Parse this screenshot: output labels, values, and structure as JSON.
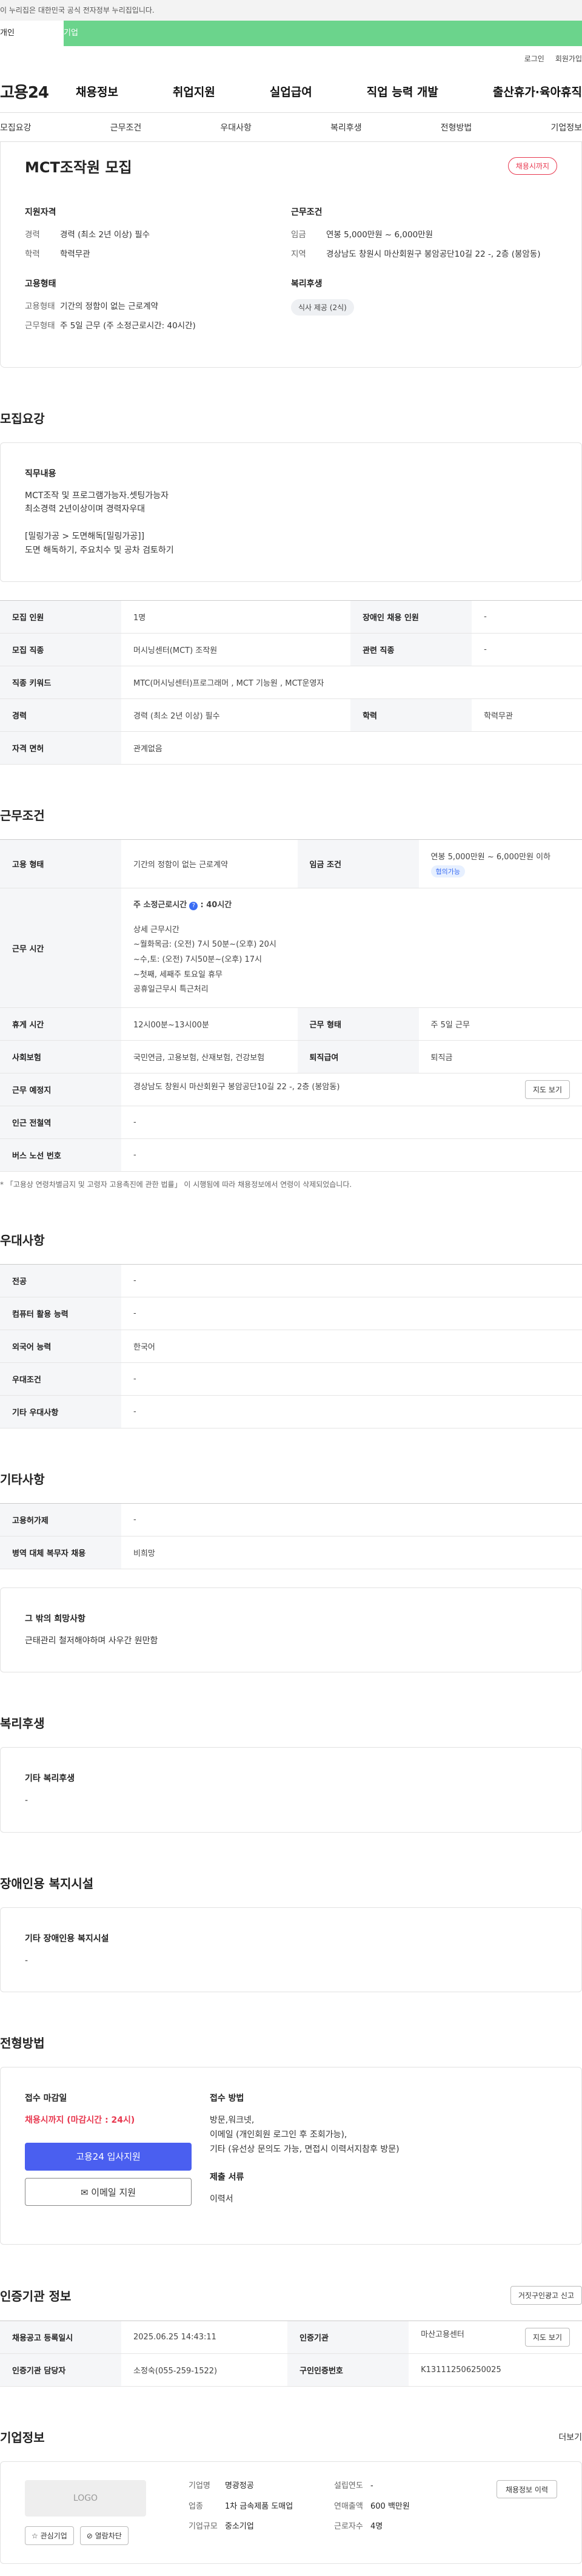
{
  "banner": "이 누리집은 대한민국 공식 전자정부 누리집입니다.",
  "tabs": {
    "person": "개인",
    "company": "기업"
  },
  "util": {
    "login": "로그인",
    "join": "회원가입"
  },
  "logo": "고용24",
  "gnb": [
    "채용정보",
    "취업지원",
    "실업급여",
    "직업 능력 개발",
    "출산휴가·육아휴직"
  ],
  "snb": [
    "모집요강",
    "근무조건",
    "우대사항",
    "복리후생",
    "전형방법",
    "기업정보"
  ],
  "summary": {
    "title": "MCT조작원 모집",
    "badge": "채용시까지",
    "qual_title": "지원자격",
    "career_k": "경력",
    "career_v": "경력 (최소 2년 이상) 필수",
    "edu_k": "학력",
    "edu_v": "학력무관",
    "emp_title": "고용형태",
    "emptype_k": "고용형태",
    "emptype_v": "기간의 정함이 없는 근로계약",
    "worktype_k": "근무형태",
    "worktype_v": "주 5일 근무 (주 소정근로시간: 40시간)",
    "cond_title": "근무조건",
    "wage_k": "임금",
    "wage_v": "연봉 5,000만원 ~ 6,000만원",
    "area_k": "지역",
    "area_v": "경상남도 창원시 마산회원구 봉암공단10길 22 -, 2층 (봉암동)",
    "welfare_title": "복리후생",
    "welfare_chip": "식사 제공 (2식)"
  },
  "recruit": {
    "section": "모집요강",
    "duty_title": "직무내용",
    "duty_lines": [
      "MCT조작 및 프로그램가능자.셋팅가능자",
      "최소경력 2년이상이며 경력자우대",
      "",
      "[밀링가공 > 도면해독[밀링가공]]",
      "도면 해독하기, 주요치수 및 공차 검토하기"
    ],
    "rows": {
      "count_k": "모집 인원",
      "count_v": "1명",
      "disabled_k": "장애인 채용 인원",
      "disabled_v": "-",
      "job_k": "모집 직종",
      "job_v": "머시닝센터(MCT) 조작원",
      "related_k": "관련 직종",
      "related_v": "-",
      "keyword_k": "직종 키워드",
      "keyword_v": "MTC(머시닝센터)프로그래머 , MCT 기능원 , MCT운영자",
      "career_k": "경력",
      "career_v": "경력 (최소 2년 이상) 필수",
      "edu_k": "학력",
      "edu_v": "학력무관",
      "license_k": "자격 면허",
      "license_v": "관계없음"
    }
  },
  "conditions": {
    "section": "근무조건",
    "emp_k": "고용 형태",
    "emp_v": "기간의 정함이 없는 근로계약",
    "wage_k": "임금 조건",
    "wage_v": "연봉 5,000만원 ~ 6,000만원 이하",
    "wage_chip": "협의가능",
    "time_k": "근무 시간",
    "time_head": "주 소정근로시간",
    "time_icon": "?",
    "time_hours": ": 40시간",
    "time_detail_title": "상세 근무시간",
    "time_lines": [
      "~월화목금: (오전) 7시 50분~(오후) 20시",
      "~수,토: (오전) 7시50분~(오후) 17시",
      "~첫째, 세째주 토요일 휴무",
      "공휴일근무시 특근처리"
    ],
    "break_k": "휴게 시간",
    "break_v": "12시00분~13시00분",
    "form_k": "근무 형태",
    "form_v": "주 5일 근무",
    "insure_k": "사회보험",
    "insure_v": "국민연금, 고용보험, 산재보험, 건강보험",
    "retire_k": "퇴직급여",
    "retire_v": "퇴직금",
    "place_k": "근무 예정지",
    "place_v": "경상남도 창원시 마산회원구 봉암공단10길 22 -, 2층 (봉암동)",
    "map_btn": "지도 보기",
    "station_k": "인근 전철역",
    "station_v": "-",
    "bus_k": "버스 노선 번호",
    "bus_v": "-",
    "note": "* 「고용상 연령차별금지 및 고령자 고용촉진에 관한 법률」 이 시행됨에 따라 채용정보에서 연령이 삭제되었습니다."
  },
  "prefer": {
    "section": "우대사항",
    "major_k": "전공",
    "major_v": "-",
    "pc_k": "컴퓨터 활용 능력",
    "pc_v": "-",
    "lang_k": "외국어 능력",
    "lang_v": "한국어",
    "cond_k": "우대조건",
    "cond_v": "-",
    "etc_k": "기타 우대사항",
    "etc_v": "-"
  },
  "etc": {
    "section": "기타사항",
    "permit_k": "고용허가제",
    "permit_v": "-",
    "army_k": "병역 대체 복무자 채용",
    "army_v": "비희망",
    "wish_title": "그 밖의 희망사항",
    "wish_v": "근태관리 철저해야하며 사우간 원만함"
  },
  "welfare": {
    "section": "복리후생",
    "title": "기타 복리후생",
    "v": "-"
  },
  "facility": {
    "section": "장애인용 복지시설",
    "title": "기타 장애인용 복지시설",
    "v": "-"
  },
  "process": {
    "section": "전형방법",
    "deadline_title": "접수 마감일",
    "deadline_v": "채용시까지 (마감시간 : 24시)",
    "apply_btn": "고용24 입사지원",
    "email_btn": "이메일 지원",
    "method_title": "접수 방법",
    "method_lines": [
      "방문,워크넷,",
      "이메일 (개인회원 로그인 후 조회가능),",
      "기타 (유선상 문의도 가능, 면접시 이력서지참후 방문)"
    ],
    "docs_title": "제출 서류",
    "docs_v": "이력서"
  },
  "agency": {
    "section": "인증기관 정보",
    "report_btn": "거짓구인광고 신고",
    "reg_k": "채용공고 등록일시",
    "reg_v": "2025.06.25 14:43:11",
    "org_k": "인증기관",
    "org_v": "마산고용센터",
    "map_btn": "지도 보기",
    "manager_k": "인증기관 담당자",
    "manager_v": "소정숙(055-259-1522)",
    "cert_k": "구인인증번호",
    "cert_v": "K131112506250025"
  },
  "company": {
    "section": "기업정보",
    "more": "더보기",
    "logo": "LOGO",
    "interest_btn": "관심기업",
    "block_btn": "열람차단",
    "name_k": "기업명",
    "name_v": "명광정공",
    "industry_k": "업종",
    "industry_v": "1차 금속제품 도매업",
    "size_k": "기업규모",
    "size_v": "중소기업",
    "year_k": "설립연도",
    "year_v": "-",
    "sales_k": "연매출액",
    "sales_v": "600 백만원",
    "emp_k": "근로자수",
    "emp_v": "4명",
    "history_btn": "채용정보 이력"
  }
}
